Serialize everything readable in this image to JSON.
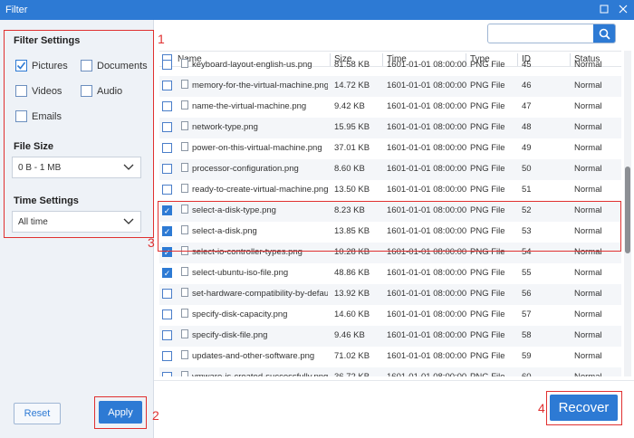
{
  "window": {
    "title": "Filter"
  },
  "filters": {
    "title": "Filter Settings",
    "types": [
      {
        "label": "Pictures",
        "checked": true
      },
      {
        "label": "Documents",
        "checked": false
      },
      {
        "label": "Videos",
        "checked": false
      },
      {
        "label": "Audio",
        "checked": false
      },
      {
        "label": "Emails",
        "checked": false
      }
    ],
    "file_size": {
      "title": "File Size",
      "value": "0 B - 1 MB"
    },
    "time": {
      "title": "Time Settings",
      "value": "All time"
    }
  },
  "buttons": {
    "reset": "Reset",
    "apply": "Apply",
    "recover": "Recover"
  },
  "annotations": [
    "1",
    "2",
    "3",
    "4"
  ],
  "search": {
    "placeholder": ""
  },
  "table": {
    "columns": [
      "Name",
      "Size",
      "Time",
      "Type",
      "ID",
      "Status"
    ],
    "rows": [
      {
        "name": "keyboard-layout-english-us.png",
        "size": "81.58 KB",
        "time": "1601-01-01 08:00:00",
        "type": "PNG File",
        "id": "45",
        "status": "Normal",
        "checked": false
      },
      {
        "name": "memory-for-the-virtual-machine.png",
        "size": "14.72 KB",
        "time": "1601-01-01 08:00:00",
        "type": "PNG File",
        "id": "46",
        "status": "Normal",
        "checked": false
      },
      {
        "name": "name-the-virtual-machine.png",
        "size": "9.42 KB",
        "time": "1601-01-01 08:00:00",
        "type": "PNG File",
        "id": "47",
        "status": "Normal",
        "checked": false
      },
      {
        "name": "network-type.png",
        "size": "15.95 KB",
        "time": "1601-01-01 08:00:00",
        "type": "PNG File",
        "id": "48",
        "status": "Normal",
        "checked": false
      },
      {
        "name": "power-on-this-virtual-machine.png",
        "size": "37.01 KB",
        "time": "1601-01-01 08:00:00",
        "type": "PNG File",
        "id": "49",
        "status": "Normal",
        "checked": false
      },
      {
        "name": "processor-configuration.png",
        "size": "8.60 KB",
        "time": "1601-01-01 08:00:00",
        "type": "PNG File",
        "id": "50",
        "status": "Normal",
        "checked": false
      },
      {
        "name": "ready-to-create-virtual-machine.png",
        "size": "13.50 KB",
        "time": "1601-01-01 08:00:00",
        "type": "PNG File",
        "id": "51",
        "status": "Normal",
        "checked": false
      },
      {
        "name": "select-a-disk-type.png",
        "size": "8.23 KB",
        "time": "1601-01-01 08:00:00",
        "type": "PNG File",
        "id": "52",
        "status": "Normal",
        "checked": true
      },
      {
        "name": "select-a-disk.png",
        "size": "13.85 KB",
        "time": "1601-01-01 08:00:00",
        "type": "PNG File",
        "id": "53",
        "status": "Normal",
        "checked": true
      },
      {
        "name": "select-io-controller-types.png",
        "size": "10.28 KB",
        "time": "1601-01-01 08:00:00",
        "type": "PNG File",
        "id": "54",
        "status": "Normal",
        "checked": true
      },
      {
        "name": "select-ubuntu-iso-file.png",
        "size": "48.86 KB",
        "time": "1601-01-01 08:00:00",
        "type": "PNG File",
        "id": "55",
        "status": "Normal",
        "checked": true
      },
      {
        "name": "set-hardware-compatibility-by-default.p",
        "size": "13.92 KB",
        "time": "1601-01-01 08:00:00",
        "type": "PNG File",
        "id": "56",
        "status": "Normal",
        "checked": false
      },
      {
        "name": "specify-disk-capacity.png",
        "size": "14.60 KB",
        "time": "1601-01-01 08:00:00",
        "type": "PNG File",
        "id": "57",
        "status": "Normal",
        "checked": false
      },
      {
        "name": "specify-disk-file.png",
        "size": "9.46 KB",
        "time": "1601-01-01 08:00:00",
        "type": "PNG File",
        "id": "58",
        "status": "Normal",
        "checked": false
      },
      {
        "name": "updates-and-other-software.png",
        "size": "71.02 KB",
        "time": "1601-01-01 08:00:00",
        "type": "PNG File",
        "id": "59",
        "status": "Normal",
        "checked": false
      },
      {
        "name": "vmware-is-created-successfully.png",
        "size": "36.72 KB",
        "time": "1601-01-01 08:00:00",
        "type": "PNG File",
        "id": "60",
        "status": "Normal",
        "checked": false
      }
    ]
  },
  "colors": {
    "accent": "#2d7ad4",
    "annotation": "#e03030"
  }
}
